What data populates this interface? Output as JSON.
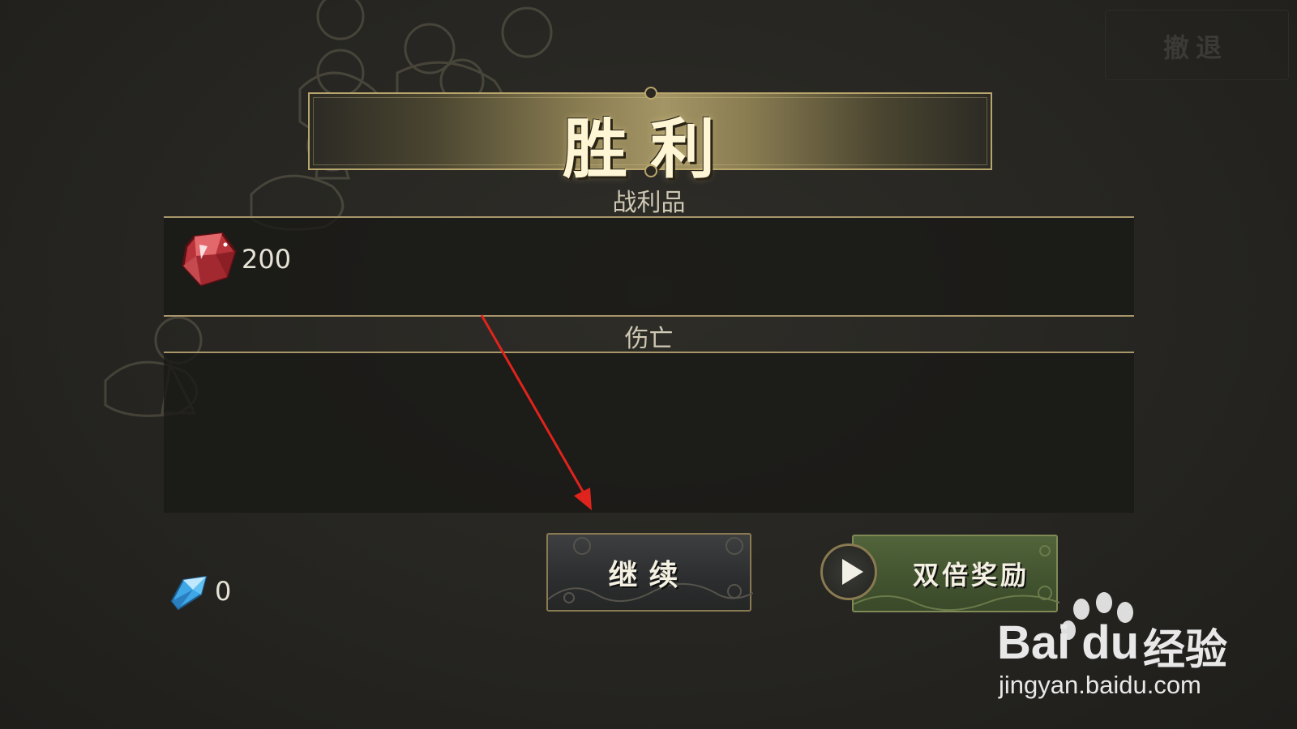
{
  "header": {
    "retreat_label": "撤退"
  },
  "result": {
    "title": "胜利"
  },
  "loot": {
    "section_label": "战利品",
    "items": [
      {
        "icon": "red-crystal-icon",
        "count": "200"
      }
    ]
  },
  "casualties": {
    "section_label": "伤亡"
  },
  "currency": {
    "icon": "blue-gem-icon",
    "count": "0"
  },
  "actions": {
    "continue_label": "继续",
    "double_reward_label": "双倍奖励",
    "double_reward_icon": "play-video-icon"
  },
  "watermark": {
    "brand_latin": "Bai",
    "brand_latin_suffix": "du",
    "brand_cn": "经验",
    "url": "jingyan.baidu.com"
  },
  "colors": {
    "gold_accent": "#b9a66c",
    "continue_button": "#2c2d2e",
    "double_button": "#435430",
    "annotation_arrow": "#e0231c"
  }
}
